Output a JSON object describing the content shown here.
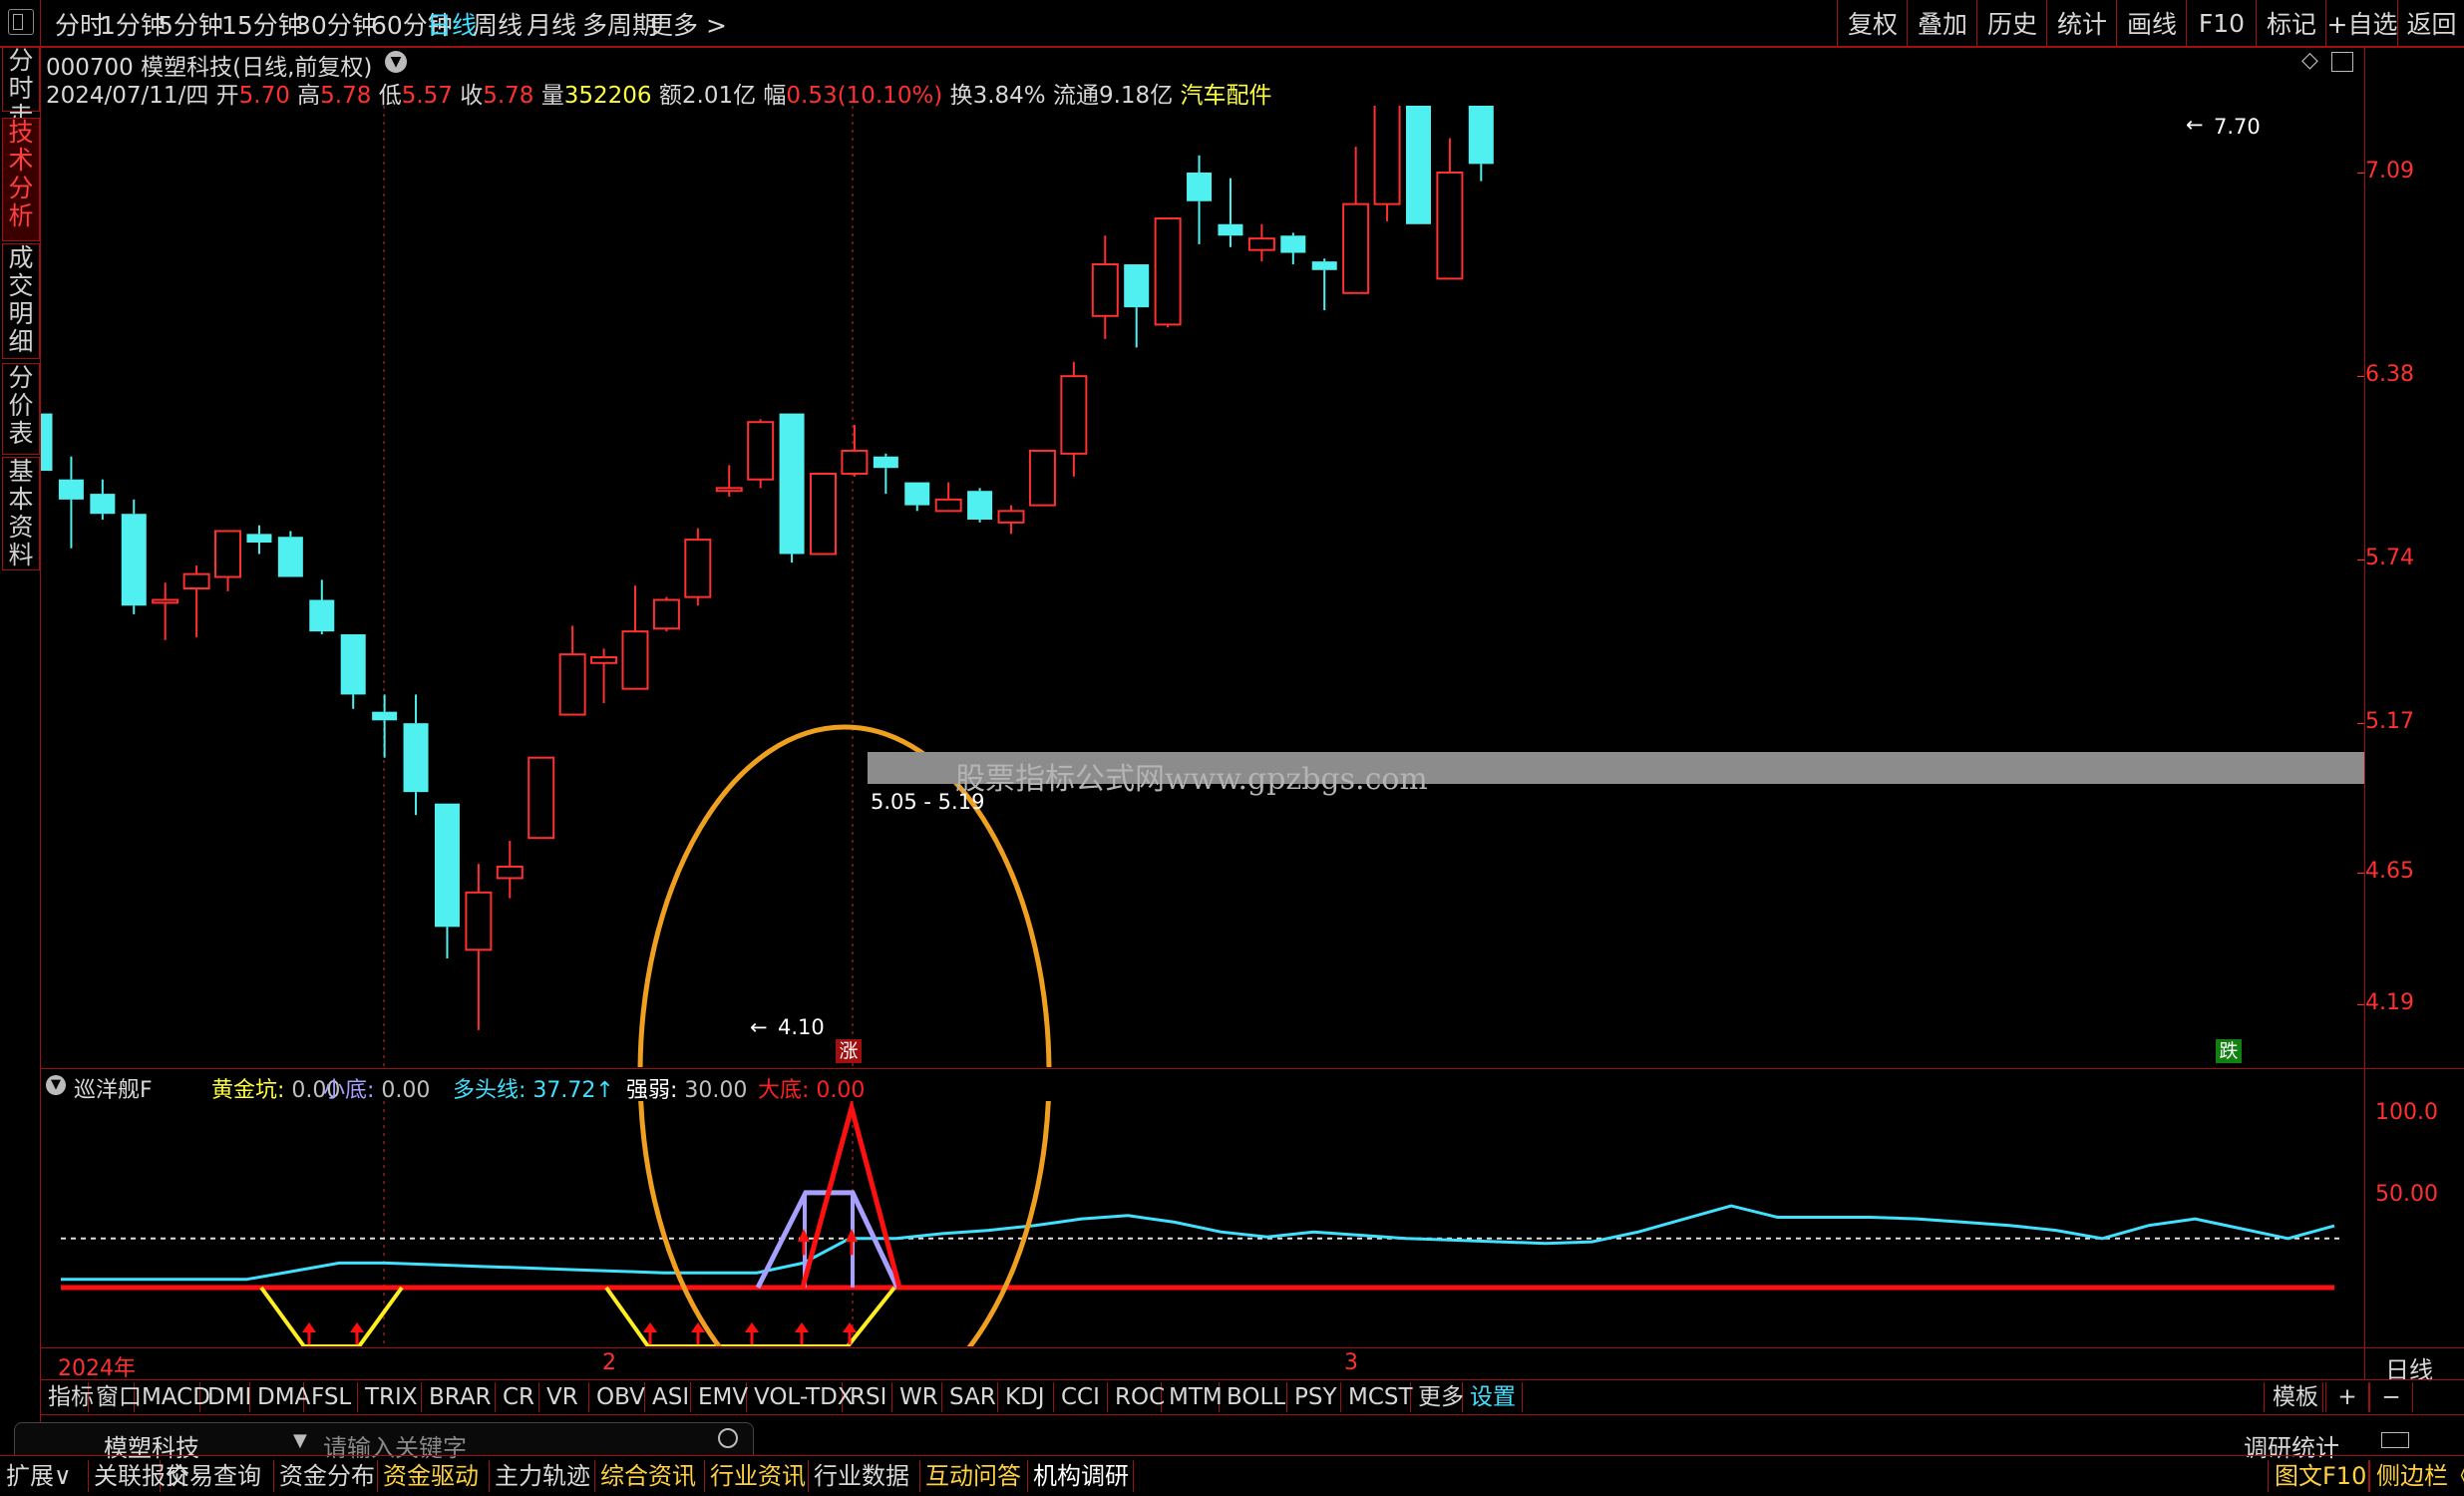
{
  "top_menu": {
    "periods": [
      "分时",
      "1分钟",
      "5分钟",
      "15分钟",
      "30分钟",
      "60分钟",
      "日线",
      "周线",
      "月线",
      "多周期",
      "更多 >"
    ],
    "active_period": "日线",
    "right_buttons": [
      "复权",
      "叠加",
      "历史",
      "统计",
      "画线",
      "F10",
      "标记",
      "+自选",
      "返回"
    ]
  },
  "left_tabs": [
    "分时走势",
    "技术分析",
    "成交明细",
    "分价表",
    "基本资料"
  ],
  "stock": {
    "code_name": "000700 模塑科技(日线,前复权)",
    "date": "2024/07/11/四",
    "open_label": "开",
    "open": "5.70",
    "high_label": "高",
    "high": "5.78",
    "low_label": "低",
    "low": "5.57",
    "close_label": "收",
    "close": "5.78",
    "vol_label": "量",
    "vol": "352206",
    "amount": "额2.01亿",
    "range_label": "幅",
    "range": "0.53(10.10%)",
    "turnover": "换3.84%",
    "float": "流通9.18亿",
    "sector": "汽车配件"
  },
  "price_axis": [
    "7.09",
    "6.38",
    "5.74",
    "5.17",
    "4.65",
    "4.19"
  ],
  "annotations": {
    "high_marker": "7.70",
    "low_marker": "4.10",
    "range_marker": "5.05 - 5.19",
    "watermark": "股票指标公式网www.gpzbgs.com",
    "up_badge": "涨",
    "down_badge": "跌"
  },
  "indicator": {
    "name": "巡洋舰F",
    "items": [
      {
        "label": "黄金坑:",
        "value": "0.00",
        "color": "#ffff40"
      },
      {
        "label": "小底:",
        "value": "0.00",
        "color": "#a8a0ff"
      },
      {
        "label": "多头线:",
        "value": "37.72↑",
        "color": "#40e0ff"
      },
      {
        "label": "强弱:",
        "value": "30.00",
        "color": "#ffffff"
      },
      {
        "label": "大底:",
        "value": "0.00",
        "color": "#ff2020"
      }
    ],
    "axis": [
      "100.0",
      "50.00"
    ]
  },
  "time_axis": {
    "labels": [
      "2024年",
      "2",
      "3"
    ],
    "period": "日线"
  },
  "indicator_tabs": [
    "指标",
    "窗口",
    "MACD",
    "DMI",
    "DMA",
    "FSL",
    "TRIX",
    "BRAR",
    "CR",
    "VR",
    "OBV",
    "ASI",
    "EMV",
    "VOL-TDX",
    "RSI",
    "WR",
    "SAR",
    "KDJ",
    "CCI",
    "ROC",
    "MTM",
    "BOLL",
    "PSY",
    "MCST",
    "更多",
    "设置"
  ],
  "indicator_tabs_right": [
    "模板",
    "+",
    "−"
  ],
  "search": {
    "stock": "模塑科技",
    "placeholder": "请输入关键字",
    "right_label": "调研统计"
  },
  "bottom_tabs": [
    {
      "label": "扩展∨",
      "color": "#d8d8d8"
    },
    {
      "label": "关联报价",
      "color": "#d8d8d8"
    },
    {
      "label": "交易查询",
      "color": "#d8d8d8"
    },
    {
      "label": "资金分布",
      "color": "#d8d8d8"
    },
    {
      "label": "资金驱动",
      "color": "#ffd040"
    },
    {
      "label": "主力轨迹",
      "color": "#d8d8d8"
    },
    {
      "label": "综合资讯",
      "color": "#ffd040"
    },
    {
      "label": "行业资讯",
      "color": "#ffd040"
    },
    {
      "label": "行业数据",
      "color": "#d8d8d8"
    },
    {
      "label": "互动问答",
      "color": "#ffd040"
    },
    {
      "label": "机构调研",
      "color": "#ffffff"
    }
  ],
  "bottom_right": [
    "图文F10",
    "侧边栏《"
  ],
  "colors": {
    "up": "#ff3030",
    "down": "#50f0f0",
    "border": "#a01010",
    "ellipse": "#f0a020"
  },
  "chart_data": {
    "type": "candlestick",
    "title": "000700 模塑科技(日线,前复权)",
    "y_ticks": [
      4.19,
      4.65,
      5.17,
      5.74,
      6.38,
      7.09
    ],
    "candles": [
      {
        "o": 6.25,
        "c": 6.05,
        "h": 6.25,
        "l": 6.05
      },
      {
        "o": 6.02,
        "c": 5.95,
        "h": 6.1,
        "l": 5.78
      },
      {
        "o": 5.97,
        "c": 5.9,
        "h": 6.02,
        "l": 5.88
      },
      {
        "o": 5.9,
        "c": 5.58,
        "h": 5.95,
        "l": 5.55
      },
      {
        "o": 5.59,
        "c": 5.6,
        "h": 5.66,
        "l": 5.46
      },
      {
        "o": 5.64,
        "c": 5.69,
        "h": 5.72,
        "l": 5.47
      },
      {
        "o": 5.68,
        "c": 5.84,
        "h": 5.84,
        "l": 5.63
      },
      {
        "o": 5.83,
        "c": 5.8,
        "h": 5.86,
        "l": 5.76
      },
      {
        "o": 5.82,
        "c": 5.68,
        "h": 5.84,
        "l": 5.68
      },
      {
        "o": 5.6,
        "c": 5.49,
        "h": 5.67,
        "l": 5.48
      },
      {
        "o": 5.48,
        "c": 5.27,
        "h": 5.48,
        "l": 5.22
      },
      {
        "o": 5.21,
        "c": 5.18,
        "h": 5.27,
        "l": 5.05
      },
      {
        "o": 5.17,
        "c": 4.93,
        "h": 5.27,
        "l": 4.85
      },
      {
        "o": 4.89,
        "c": 4.46,
        "h": 4.89,
        "l": 4.35
      },
      {
        "o": 4.38,
        "c": 4.58,
        "h": 4.68,
        "l": 4.1
      },
      {
        "o": 4.63,
        "c": 4.67,
        "h": 4.76,
        "l": 4.56
      },
      {
        "o": 4.77,
        "c": 5.05,
        "h": 5.05,
        "l": 4.77
      },
      {
        "o": 5.2,
        "c": 5.41,
        "h": 5.51,
        "l": 5.2
      },
      {
        "o": 5.38,
        "c": 5.4,
        "h": 5.43,
        "l": 5.24
      },
      {
        "o": 5.29,
        "c": 5.49,
        "h": 5.65,
        "l": 5.29
      },
      {
        "o": 5.5,
        "c": 5.6,
        "h": 5.61,
        "l": 5.49
      },
      {
        "o": 5.61,
        "c": 5.81,
        "h": 5.85,
        "l": 5.58
      },
      {
        "o": 5.98,
        "c": 5.99,
        "h": 6.07,
        "l": 5.96
      },
      {
        "o": 6.02,
        "c": 6.22,
        "h": 6.23,
        "l": 5.99
      },
      {
        "o": 6.25,
        "c": 5.76,
        "h": 6.25,
        "l": 5.73
      },
      {
        "o": 5.76,
        "c": 6.04,
        "h": 6.04,
        "l": 5.76
      },
      {
        "o": 6.04,
        "c": 6.12,
        "h": 6.21,
        "l": 6.03
      },
      {
        "o": 6.1,
        "c": 6.06,
        "h": 6.11,
        "l": 5.97
      },
      {
        "o": 6.01,
        "c": 5.93,
        "h": 6.01,
        "l": 5.91
      },
      {
        "o": 5.91,
        "c": 5.95,
        "h": 6.01,
        "l": 5.91
      },
      {
        "o": 5.98,
        "c": 5.88,
        "h": 5.99,
        "l": 5.87
      },
      {
        "o": 5.87,
        "c": 5.91,
        "h": 5.93,
        "l": 5.83
      },
      {
        "o": 5.93,
        "c": 6.12,
        "h": 6.12,
        "l": 5.93
      },
      {
        "o": 6.11,
        "c": 6.38,
        "h": 6.43,
        "l": 6.03
      },
      {
        "o": 6.59,
        "c": 6.77,
        "h": 6.87,
        "l": 6.51
      },
      {
        "o": 6.77,
        "c": 6.62,
        "h": 6.77,
        "l": 6.48
      },
      {
        "o": 6.56,
        "c": 6.93,
        "h": 6.93,
        "l": 6.55
      },
      {
        "o": 7.09,
        "c": 6.99,
        "h": 7.15,
        "l": 6.84
      },
      {
        "o": 6.91,
        "c": 6.87,
        "h": 7.07,
        "l": 6.83
      },
      {
        "o": 6.82,
        "c": 6.86,
        "h": 6.91,
        "l": 6.78
      },
      {
        "o": 6.87,
        "c": 6.81,
        "h": 6.88,
        "l": 6.77
      },
      {
        "o": 6.78,
        "c": 6.75,
        "h": 6.79,
        "l": 6.61
      },
      {
        "o": 6.67,
        "c": 6.98,
        "h": 7.18,
        "l": 6.67
      },
      {
        "o": 6.98,
        "c": 7.58,
        "h": 7.7,
        "l": 6.92
      },
      {
        "o": 7.33,
        "c": 6.91,
        "h": 7.33,
        "l": 6.91
      },
      {
        "o": 6.72,
        "c": 7.09,
        "h": 7.21,
        "l": 6.72
      },
      {
        "o": 7.52,
        "c": 7.12,
        "h": 7.59,
        "l": 7.06
      }
    ],
    "indicator_series": [
      {
        "name": "多头线",
        "color": "#40e0ff",
        "values": [
          5,
          5,
          5,
          5,
          5,
          10,
          15,
          15,
          14,
          13,
          12,
          11,
          10,
          9,
          9,
          9,
          15,
          30,
          30,
          33,
          35,
          38,
          42,
          44,
          40,
          34,
          31,
          34,
          32,
          30,
          29,
          28,
          27,
          28,
          34,
          42,
          50,
          43,
          43,
          43,
          42,
          40,
          38,
          35,
          30,
          38,
          42,
          36,
          30,
          37.72
        ]
      }
    ]
  }
}
